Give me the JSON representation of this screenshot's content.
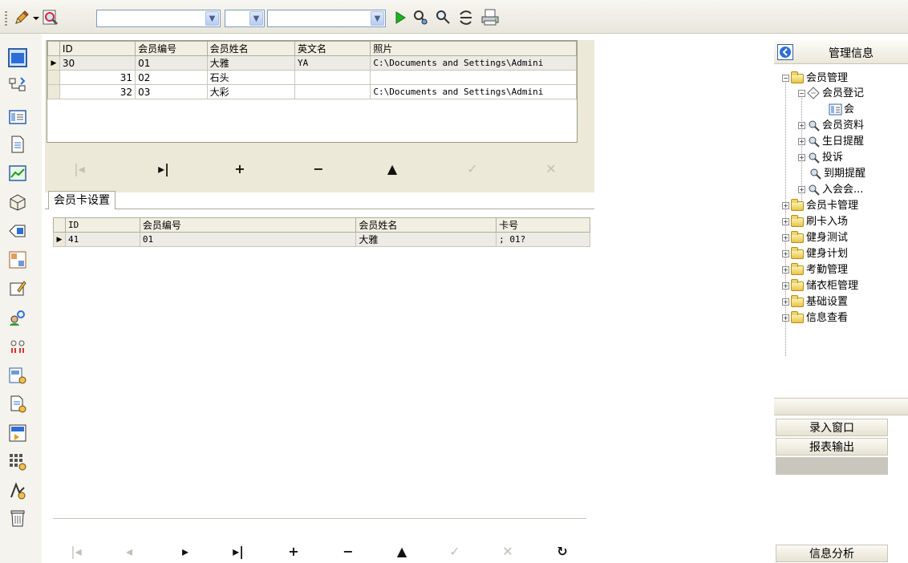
{
  "toolbar": {
    "combo1_value": "",
    "combo2_value": "",
    "combo3_value": ""
  },
  "members_grid": {
    "columns": [
      "ID",
      "会员编号",
      "会员姓名",
      "英文名",
      "照片"
    ],
    "rows": [
      {
        "id": "30",
        "no": "01",
        "name": "大雅",
        "en": "YA",
        "photo": "C:\\Documents and Settings\\Admini"
      },
      {
        "id": "31",
        "no": "02",
        "name": "石头",
        "en": "",
        "photo": ""
      },
      {
        "id": "32",
        "no": "03",
        "name": "大彩",
        "en": "",
        "photo": "C:\\Documents and Settings\\Admini"
      }
    ]
  },
  "tab": {
    "label": "会员卡设置"
  },
  "card_grid": {
    "columns": [
      "ID",
      "会员编号",
      "会员姓名",
      "卡号"
    ],
    "rows": [
      {
        "id": "41",
        "no": "01",
        "name": "大雅",
        "card": "; 01?"
      }
    ]
  },
  "right_panel": {
    "title": "管理信息",
    "tree": [
      {
        "label": "会员管理"
      },
      {
        "label": "会员登记"
      },
      {
        "label": "会"
      },
      {
        "label": "会员资料"
      },
      {
        "label": "生日提醒"
      },
      {
        "label": "投诉"
      },
      {
        "label": "到期提醒"
      },
      {
        "label": "入会会..."
      },
      {
        "label": "会员卡管理"
      },
      {
        "label": "刷卡入场"
      },
      {
        "label": "健身测试"
      },
      {
        "label": "健身计划"
      },
      {
        "label": "考勤管理"
      },
      {
        "label": "储衣柜管理"
      },
      {
        "label": "基础设置"
      },
      {
        "label": "信息查看"
      }
    ],
    "buttons": {
      "entry_window": "录入窗口",
      "report_output": "报表输出",
      "info_analysis": "信息分析"
    }
  },
  "colors": {
    "accent": "#316ac5",
    "toolbar_bg": "#ece9d8"
  }
}
